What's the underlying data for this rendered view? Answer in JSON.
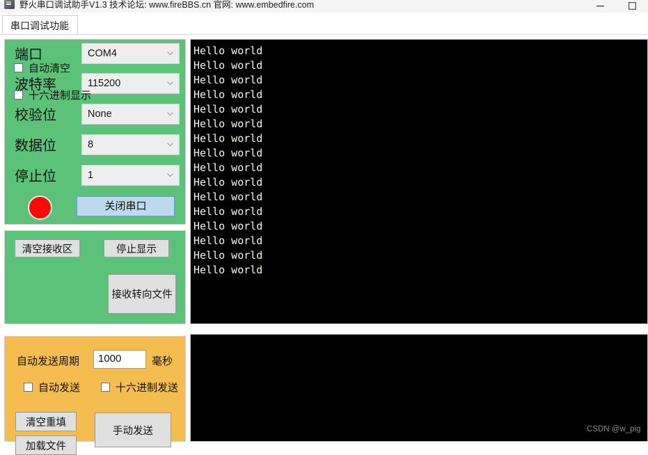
{
  "window": {
    "title": "野火串口调试助手V1.3    技术论坛: www.fireBBS.cn  官网: www.embedfire.com",
    "minimize_icon": "minimize-icon",
    "maximize_icon": "maximize-icon"
  },
  "tabs": [
    {
      "label": "串口调试功能",
      "active": true
    }
  ],
  "settings_panel": {
    "background_color": "#5cc279",
    "rows": [
      {
        "label": "端口",
        "value": "COM4",
        "name": "port"
      },
      {
        "label": "波特率",
        "value": "115200",
        "name": "baudrate"
      },
      {
        "label": "校验位",
        "value": "None",
        "name": "parity"
      },
      {
        "label": "数据位",
        "value": "8",
        "name": "databits"
      },
      {
        "label": "停止位",
        "value": "1",
        "name": "stopbits"
      }
    ],
    "status_led": {
      "color": "#fb0808",
      "state": "open"
    },
    "toggle_button": {
      "label": "关闭串口",
      "color": "#bcd9ee"
    }
  },
  "receive_panel": {
    "background_color": "#5cc279",
    "clear_button": "清空接收区",
    "stop_button": "停止显示",
    "redirect_button": "接收转向文件",
    "auto_clear_checkbox": {
      "label": "自动清空",
      "checked": false
    },
    "hex_display_checkbox": {
      "label": "十六进制显示",
      "checked": false
    }
  },
  "send_panel": {
    "background_color": "#f5bd4f",
    "period_label": "自动发送周期",
    "period_value": "1000",
    "period_placeholder": "1000",
    "period_unit": "毫秒",
    "auto_send_checkbox": {
      "label": "自动发送",
      "checked": false
    },
    "hex_send_checkbox": {
      "label": "十六进制发送",
      "checked": false
    },
    "clear_refill_button": "清空重填",
    "load_file_button": "加载文件",
    "manual_send_button": "手动发送"
  },
  "receive_area": {
    "background_color": "#000000",
    "text_color": "#fdf4e6",
    "lines": [
      "Hello world",
      "Hello world",
      "Hello world",
      "Hello world",
      "Hello world",
      "Hello world",
      "Hello world",
      "Hello world",
      "Hello world",
      "Hello world",
      "Hello world",
      "Hello world",
      "Hello world",
      "Hello world",
      "Hello world",
      "Hello world"
    ]
  },
  "send_area": {
    "background_color": "#000000",
    "content": ""
  },
  "watermark": "CSDN @w_pig"
}
